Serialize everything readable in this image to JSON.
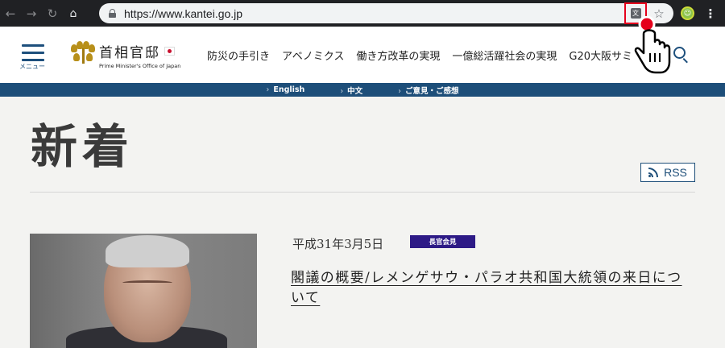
{
  "browser": {
    "url": "https://www.kantei.go.jp",
    "back_glyph": "←",
    "forward_glyph": "→",
    "reload_glyph": "↻",
    "home_glyph": "⌂",
    "star_glyph": "☆",
    "menu_glyph": "⋮",
    "translate_glyph": "文",
    "extension_glyph": "☺",
    "icons": [
      "back-icon",
      "forward-icon",
      "reload-icon",
      "home-icon",
      "lock-icon",
      "translate-icon",
      "bookmark-star-icon",
      "extension-icon",
      "menu-dots-icon"
    ]
  },
  "header": {
    "menu_label": "メニュー",
    "logo_jp": "首相官邸",
    "logo_en": "Prime Minister's Office of Japan",
    "nav": [
      "防災の手引き",
      "アベノミクス",
      "働き方改革の実現",
      "一億総活躍社会の実現",
      "G20大阪サミット"
    ],
    "accent": "#1d4f7c"
  },
  "subnav": {
    "chevron": "›",
    "links": [
      "English",
      "中文",
      "ご意見・ご感想"
    ],
    "background": "#1d4e79"
  },
  "main": {
    "title": "新着",
    "rss_label": "RSS",
    "news": {
      "date": "平成31年3月5日",
      "tag": "長官会見",
      "tag_color": "#2d1a86",
      "title": "閣議の概要/レメンゲサウ・パラオ共和国大統領の来日について"
    }
  },
  "highlight_color": "#e5001c"
}
